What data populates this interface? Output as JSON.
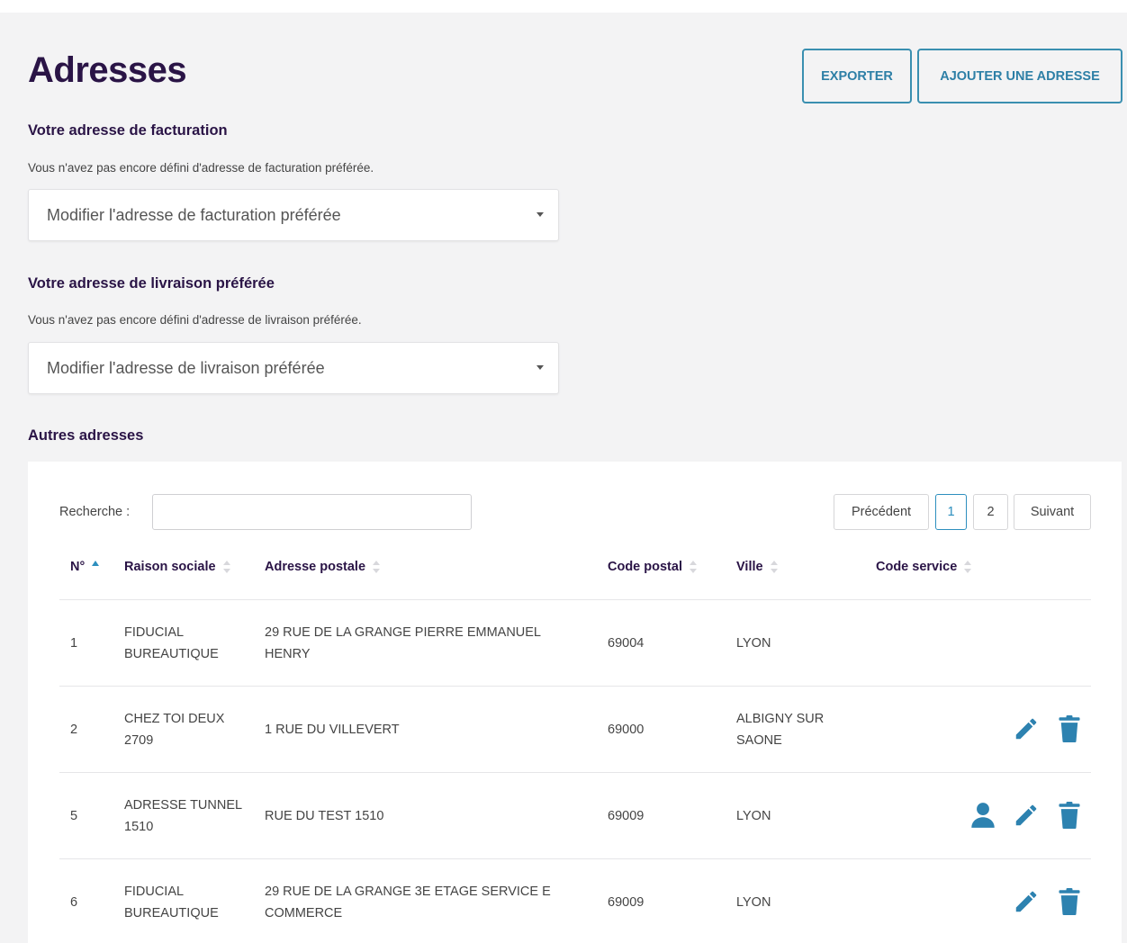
{
  "header": {
    "title": "Adresses",
    "export_label": "EXPORTER",
    "add_label": "AJOUTER UNE ADRESSE"
  },
  "billing": {
    "heading": "Votre adresse de facturation",
    "helper": "Vous n'avez pas encore défini d'adresse de facturation préférée.",
    "select_value": "Modifier l'adresse de facturation préférée"
  },
  "delivery": {
    "heading": "Votre adresse de livraison préférée",
    "helper": "Vous n'avez pas encore défini d'adresse de livraison préférée.",
    "select_value": "Modifier l'adresse de livraison préférée"
  },
  "others": {
    "heading": "Autres adresses",
    "search_label": "Recherche :",
    "search_value": "",
    "pager": {
      "prev": "Précédent",
      "page1": "1",
      "page2": "2",
      "next": "Suivant"
    },
    "columns": {
      "num": "N°",
      "company": "Raison sociale",
      "address": "Adresse postale",
      "zip": "Code postal",
      "city": "Ville",
      "service": "Code service"
    },
    "rows": [
      {
        "num": "1",
        "company": "FIDUCIAL BUREAUTIQUE",
        "address": "29 RUE DE LA GRANGE PIERRE EMMANUEL HENRY",
        "zip": "69004",
        "city": "LYON",
        "service": ""
      },
      {
        "num": "2",
        "company": "CHEZ TOI DEUX 2709",
        "address": "1 RUE DU VILLEVERT",
        "zip": "69000",
        "city": "ALBIGNY SUR SAONE",
        "service": ""
      },
      {
        "num": "5",
        "company": "ADRESSE TUNNEL 1510",
        "address": "RUE DU TEST 1510",
        "zip": "69009",
        "city": "LYON",
        "service": ""
      },
      {
        "num": "6",
        "company": "FIDUCIAL BUREAUTIQUE",
        "address": "29 RUE DE LA GRANGE 3E ETAGE SERVICE E COMMERCE",
        "zip": "69009",
        "city": "LYON",
        "service": ""
      }
    ]
  },
  "colors": {
    "brand_dark": "#2a1446",
    "accent": "#2d8fbe",
    "icon": "#2d82b0"
  },
  "icons": {
    "user": "user-icon",
    "edit": "pencil-icon",
    "delete": "trash-icon"
  }
}
